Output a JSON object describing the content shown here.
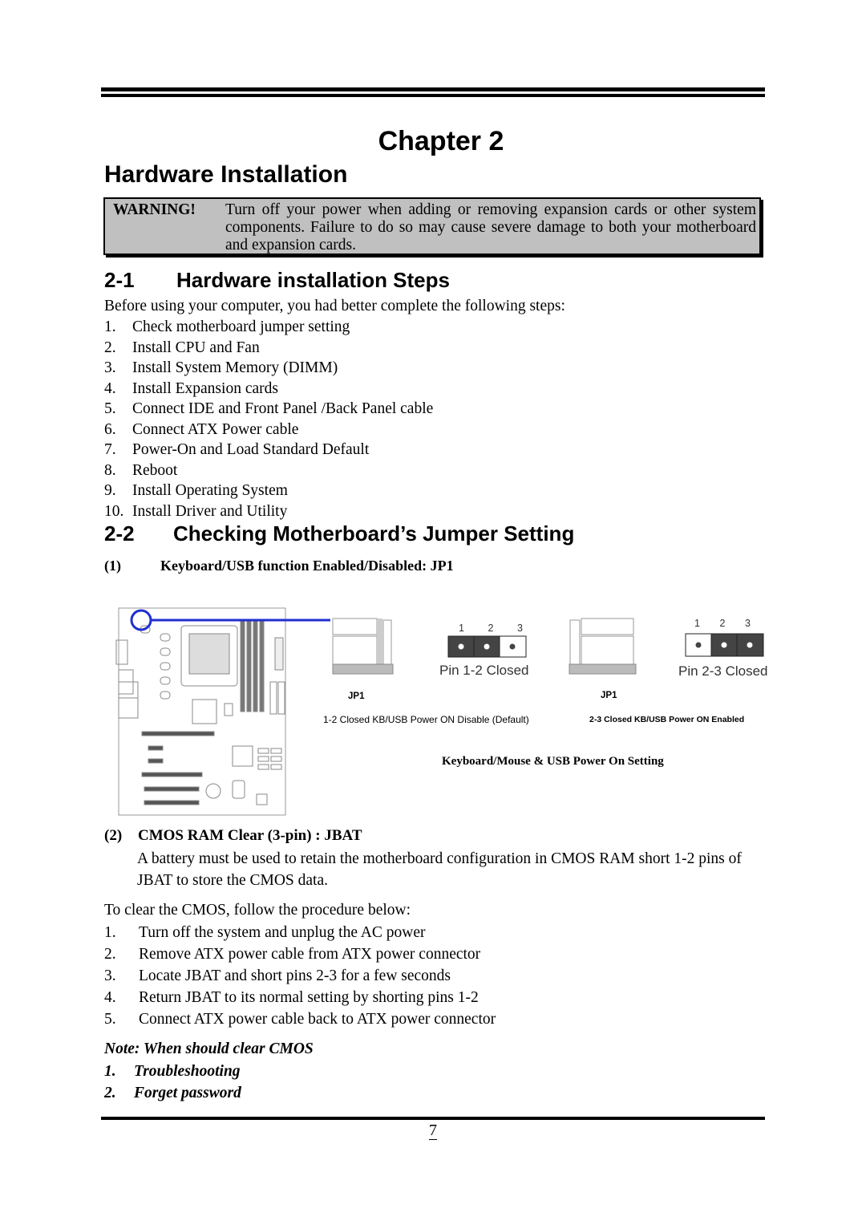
{
  "chapter_title": "Chapter 2",
  "page_title": "Hardware Installation",
  "warning": {
    "label": "WARNING!",
    "text": "Turn off your power when adding or removing expansion cards or other system components.  Failure to do so may cause severe damage to both your motherboard and expansion cards."
  },
  "section1": {
    "number": "2-1",
    "title": "Hardware installation Steps",
    "intro": "Before using your computer, you had better complete the following steps:",
    "steps": [
      {
        "n": "1.",
        "text": "Check motherboard jumper setting"
      },
      {
        "n": "2.",
        "text": "Install CPU and Fan"
      },
      {
        "n": "3.",
        "text": "Install System Memory (DIMM)"
      },
      {
        "n": "4.",
        "text": "Install Expansion cards"
      },
      {
        "n": "5.",
        "text": "Connect IDE and Front Panel /Back Panel cable"
      },
      {
        "n": "6.",
        "text": "Connect ATX Power cable"
      },
      {
        "n": "7.",
        "text": "Power-On and Load Standard Default"
      },
      {
        "n": "8.",
        "text": "Reboot"
      },
      {
        "n": "9.",
        "text": "Install Operating System"
      },
      {
        "n": "10.",
        "text": "Install Driver and Utility"
      }
    ]
  },
  "section2": {
    "number": "2-2",
    "title": "Checking Motherboard’s Jumper Setting",
    "jp1": {
      "n": "(1)",
      "title": "Keyboard/USB function Enabled/Disabled: JP1",
      "left": {
        "pins": [
          "1",
          "2",
          "3"
        ],
        "pin_label": "Pin  1-2  Closed",
        "jumper_label": "JP1",
        "caption": "1-2 Closed KB/USB Power ON Disable (Default)"
      },
      "right": {
        "pins": [
          "1",
          "2",
          "3"
        ],
        "pin_label": "Pin  2-3  Closed",
        "jumper_label": "JP1",
        "caption": "2-3 Closed KB/USB Power ON Enabled"
      },
      "figure_caption": "Keyboard/Mouse & USB Power On Setting",
      "highlight_color": "#1f2fd0"
    },
    "jbat": {
      "n": "(2)",
      "title": "CMOS RAM Clear (3-pin) : JBAT",
      "description": "A battery must be used to retain the motherboard configuration in CMOS RAM short 1-2 pins of JBAT to store the CMOS data.",
      "procedure_intro": "To clear the CMOS, follow the procedure below:",
      "steps": [
        {
          "n": "1.",
          "text": "Turn off the system and unplug the AC power"
        },
        {
          "n": "2.",
          "text": "Remove ATX power cable from ATX power connector"
        },
        {
          "n": "3.",
          "text": "Locate JBAT and short pins 2-3 for a few seconds"
        },
        {
          "n": "4.",
          "text": "Return JBAT to its normal setting by shorting pins 1-2"
        },
        {
          "n": "5.",
          "text": "Connect ATX power cable back to ATX power connector"
        }
      ]
    },
    "note": {
      "title": "Note: When should clear CMOS",
      "items": [
        {
          "n": "1.",
          "text": "Troubleshooting"
        },
        {
          "n": "2.",
          "text": "Forget password"
        }
      ]
    }
  },
  "page_number": "7"
}
